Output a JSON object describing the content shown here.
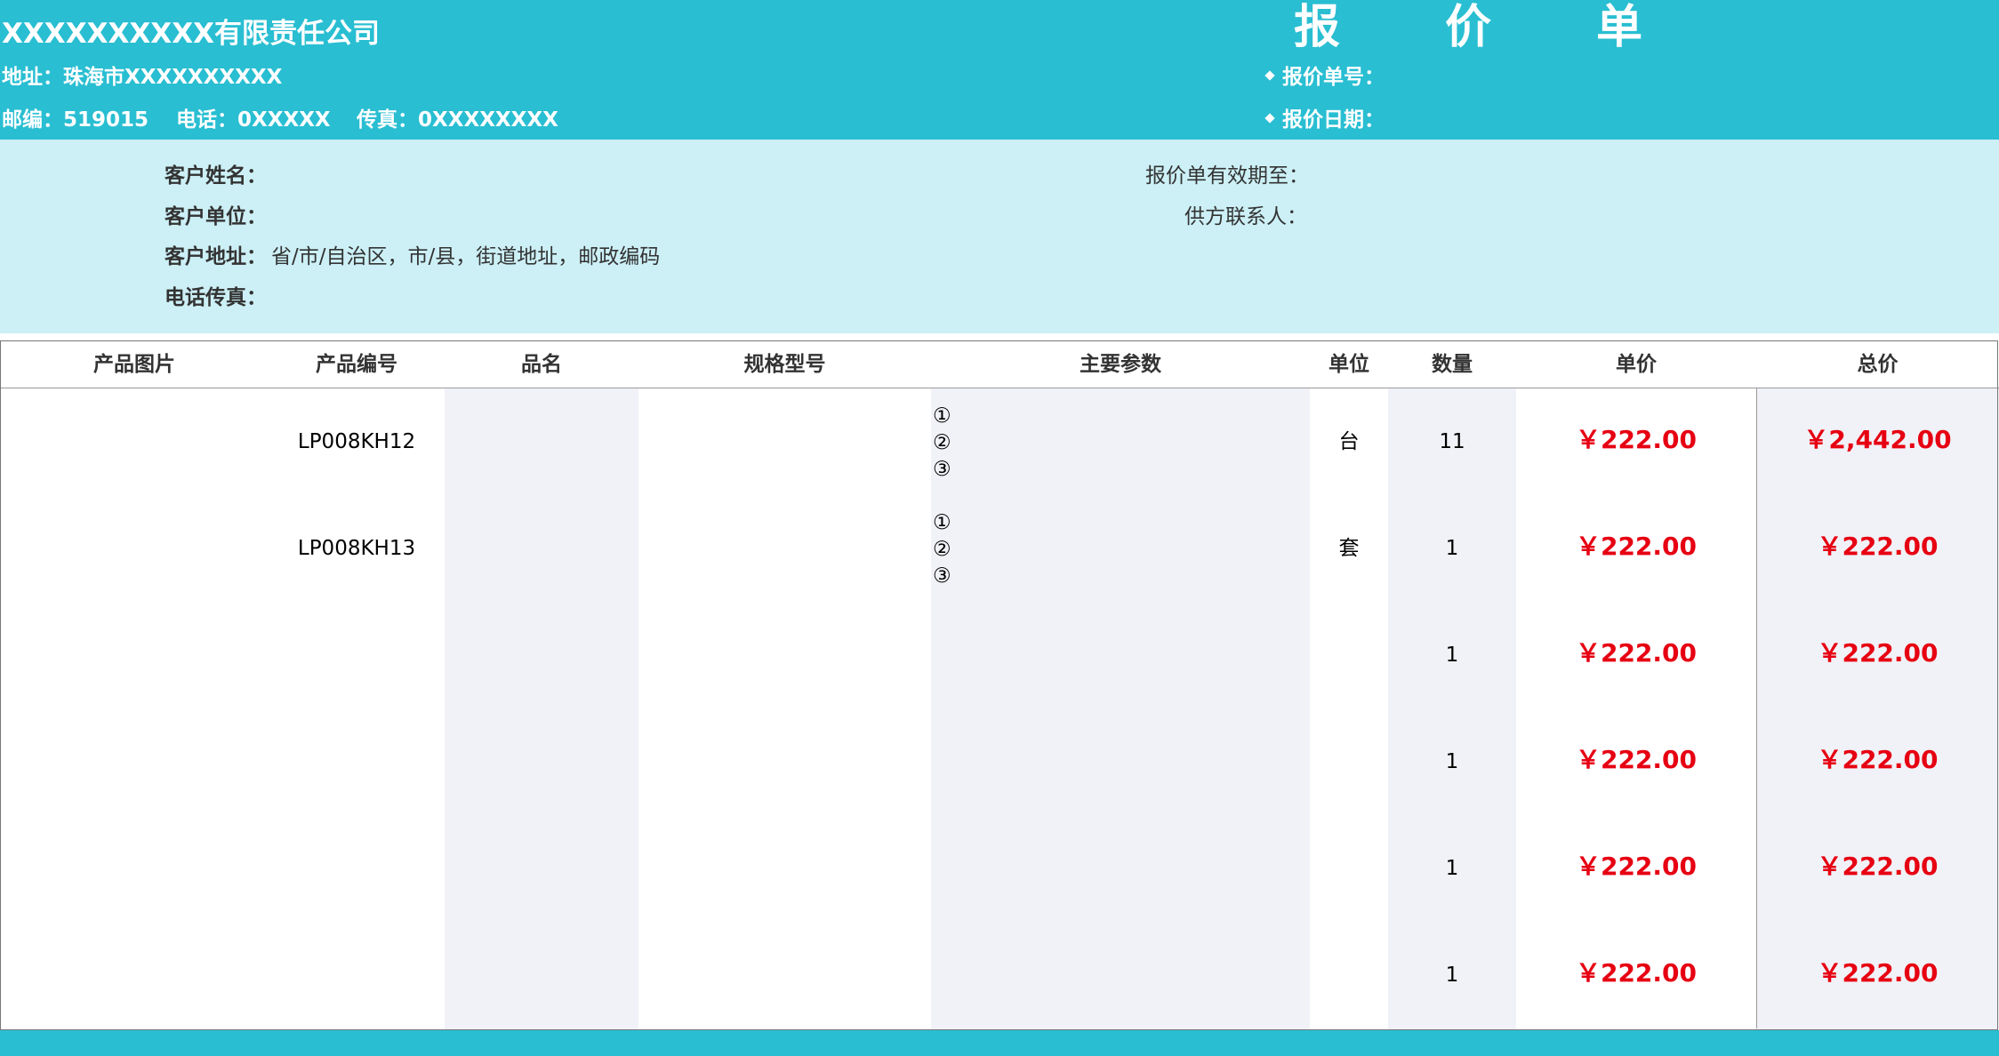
{
  "header": {
    "company": "XXXXXXXXXX有限责任公司",
    "title_chars": [
      "报",
      "价",
      "单"
    ],
    "address": "地址：珠海市XXXXXXXXXX",
    "postcode": "邮编：519015",
    "phone": "电话：0XXXXX",
    "fax": "传真：0XXXXXXXX",
    "quote_no_label": "报价单号：",
    "quote_date_label": "报价日期："
  },
  "client": {
    "name_label": "客户姓名：",
    "unit_label": "客户单位：",
    "address_label": "客户地址：",
    "address_value": "省/市/自治区，市/县，街道地址，邮政编码",
    "phone_fax_label": "电话传真：",
    "valid_until_label": "报价单有效期至：",
    "supplier_contact_label": "供方联系人："
  },
  "table": {
    "columns": [
      "产品图片",
      "产品编号",
      "品名",
      "规格型号",
      "主要参数",
      "单位",
      "数量",
      "单价",
      "总价"
    ],
    "rows": [
      {
        "code": "LP008KH12",
        "params": [
          "①",
          "②",
          "③"
        ],
        "unit": "台",
        "qty": "11",
        "price": "￥222.00",
        "total": "￥2,442.00"
      },
      {
        "code": "LP008KH13",
        "params": [
          "①",
          "②",
          "③"
        ],
        "unit": "套",
        "qty": "1",
        "price": "￥222.00",
        "total": "￥222.00"
      },
      {
        "code": "",
        "params": [],
        "unit": "",
        "qty": "1",
        "price": "￥222.00",
        "total": "￥222.00"
      },
      {
        "code": "",
        "params": [],
        "unit": "",
        "qty": "1",
        "price": "￥222.00",
        "total": "￥222.00"
      },
      {
        "code": "",
        "params": [],
        "unit": "",
        "qty": "1",
        "price": "￥222.00",
        "total": "￥222.00"
      },
      {
        "code": "",
        "params": [],
        "unit": "",
        "qty": "1",
        "price": "￥222.00",
        "total": "￥222.00"
      }
    ]
  },
  "colors": {
    "header_bg": "#29BED2",
    "client_bg": "#CCF0F6",
    "alt_col_bg": "#F1F2F7",
    "price_red": "#E60012"
  }
}
